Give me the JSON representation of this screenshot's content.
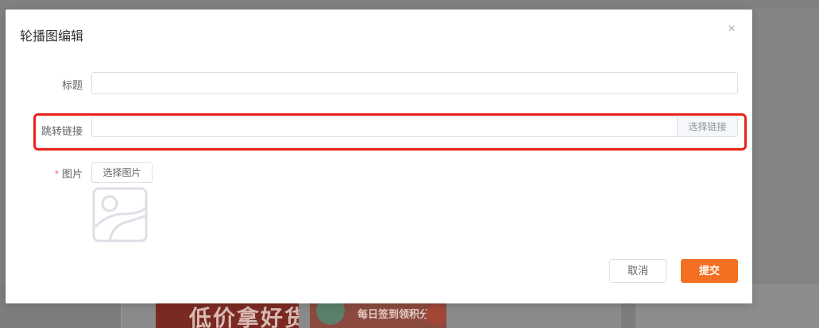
{
  "dialog": {
    "title": "轮播图编辑",
    "close_icon": "close-icon",
    "close_glyph": "×"
  },
  "form": {
    "title_label": "标题",
    "title_value": "",
    "link_label": "跳转链接",
    "link_value": "",
    "link_select_button": "选择链接",
    "image_label": "图片",
    "image_required_mark": "*",
    "image_select_button": "选择图片",
    "image_placeholder_icon": "image-placeholder-icon"
  },
  "footer": {
    "cancel_label": "取消",
    "submit_label": "提交"
  },
  "background": {
    "banner_1_text": "低价拿好货",
    "banner_2_text": "每日签到领积分"
  },
  "colors": {
    "accent": "#f36f21",
    "highlight": "#e8221a",
    "required": "#f56c6c"
  }
}
